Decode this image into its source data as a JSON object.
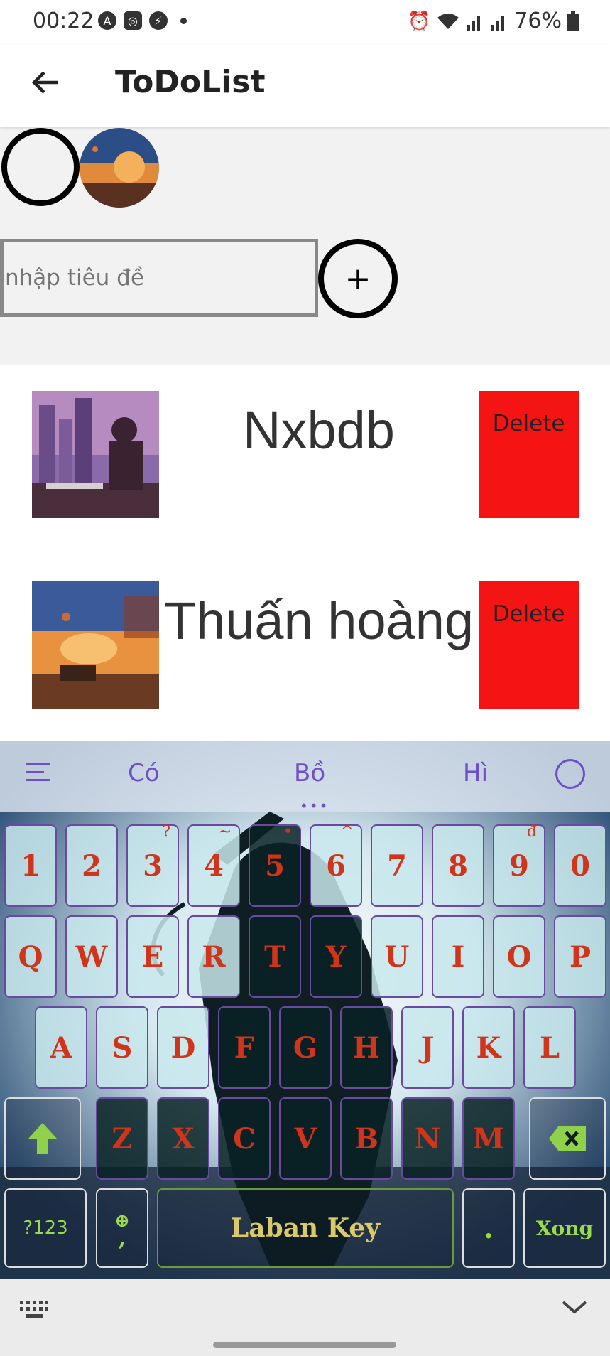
{
  "status_bar": {
    "time": "00:22",
    "battery": "76%"
  },
  "app_bar": {
    "title": "ToDoList"
  },
  "input": {
    "placeholder": "nhập tiêu đề",
    "add_label": "+"
  },
  "todos": [
    {
      "title": "Nxbdb",
      "delete_label": "Delete"
    },
    {
      "title": "Thuấn hoàng",
      "delete_label": "Delete"
    }
  ],
  "keyboard": {
    "suggestions": [
      "Có",
      "Bồ",
      "Hì"
    ],
    "number_row": [
      "1",
      "2",
      "3",
      "4",
      "5",
      "6",
      "7",
      "8",
      "9",
      "0"
    ],
    "number_hints": [
      "",
      "",
      "?",
      "~",
      "•",
      "^",
      "",
      "",
      "đ",
      ""
    ],
    "row1": [
      "Q",
      "W",
      "E",
      "R",
      "T",
      "Y",
      "U",
      "I",
      "O",
      "P"
    ],
    "row2": [
      "A",
      "S",
      "D",
      "F",
      "G",
      "H",
      "J",
      "K",
      "L"
    ],
    "row3": [
      "Z",
      "X",
      "C",
      "V",
      "B",
      "N",
      "M"
    ],
    "symbols_label": "?123",
    "comma_label": ",",
    "space_label": "Laban Key",
    "period_label": ".",
    "enter_label": "Xong",
    "accent_color": "#d0341a",
    "func_color": "#9adb4a"
  }
}
